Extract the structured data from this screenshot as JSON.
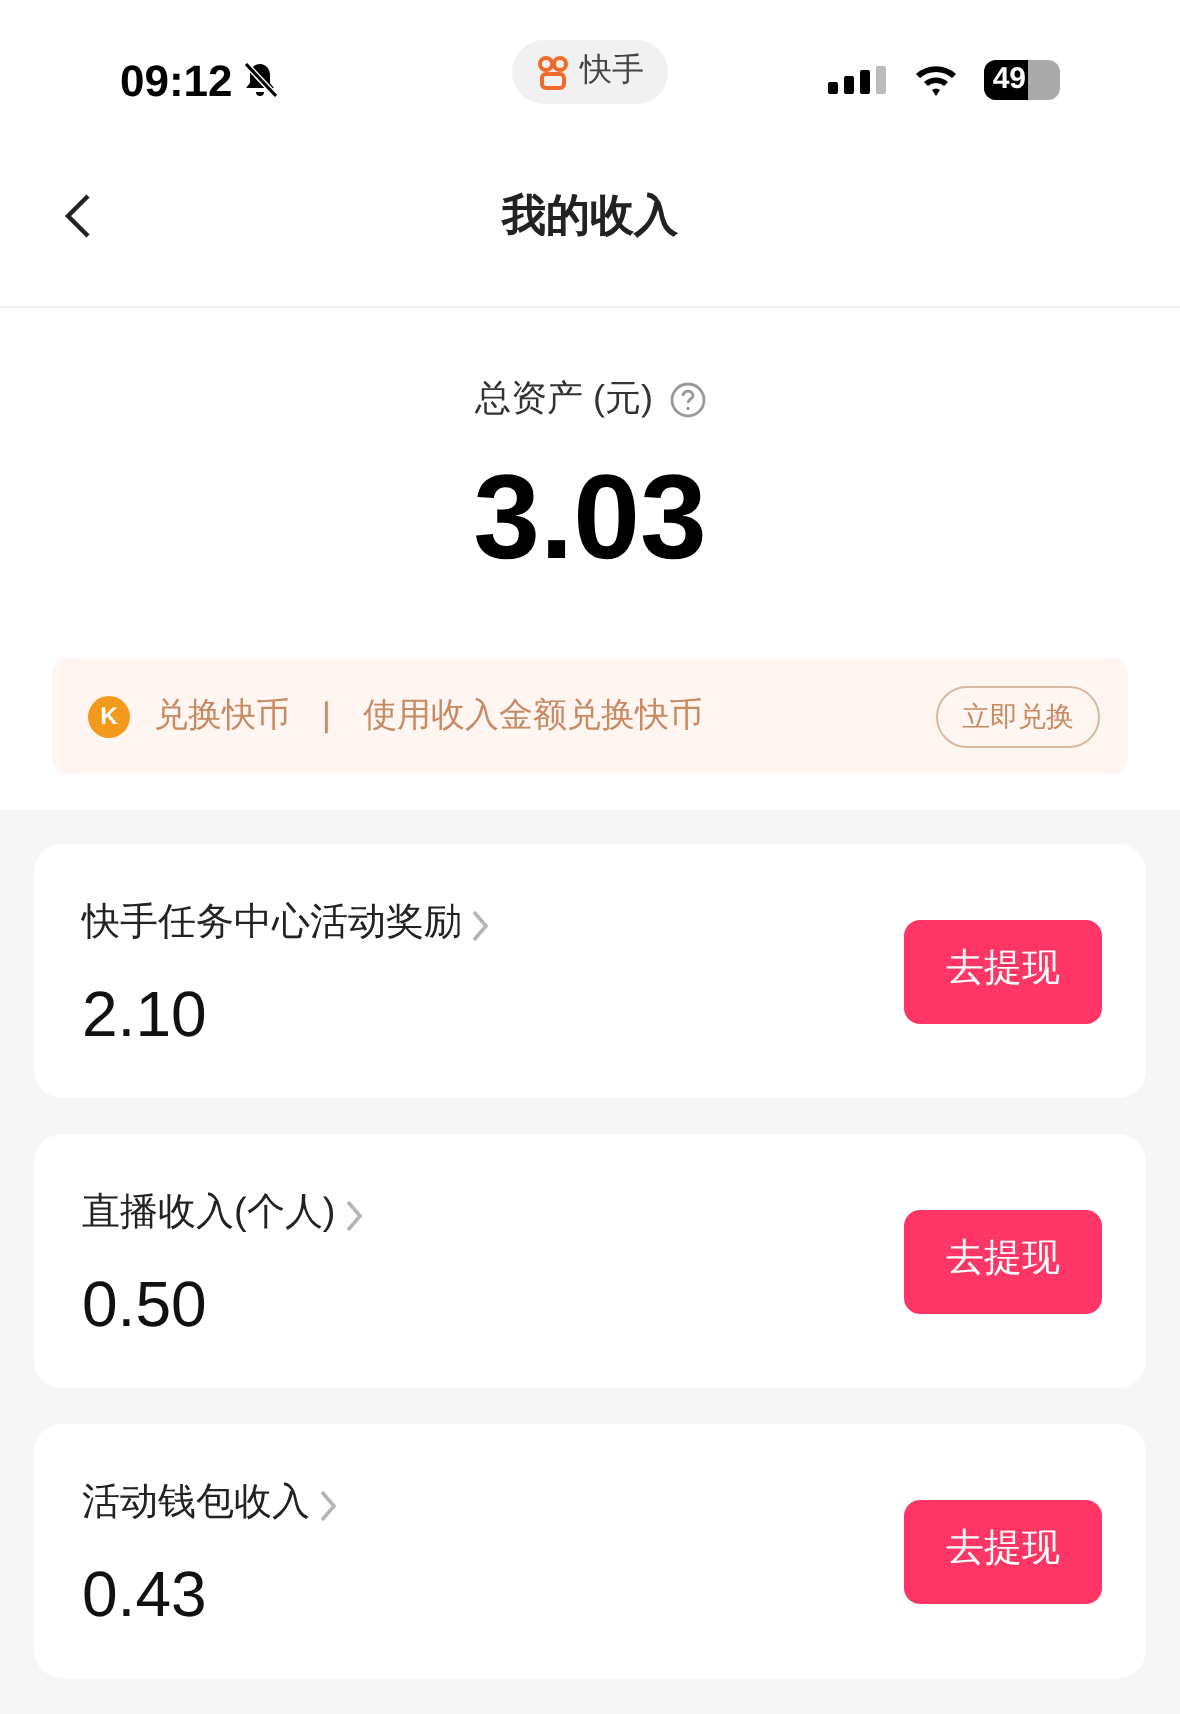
{
  "status_bar": {
    "time": "09:12",
    "app_pill": "快手",
    "battery": "49"
  },
  "header": {
    "title": "我的收入"
  },
  "total": {
    "label": "总资产 (元)",
    "amount": "3.03"
  },
  "exchange_banner": {
    "coin": "K",
    "title": "兑换快币",
    "separator": "|",
    "description": "使用收入金额兑换快币",
    "button": "立即兑换"
  },
  "income_items": [
    {
      "title": "快手任务中心活动奖励",
      "amount": "2.10",
      "button": "去提现"
    },
    {
      "title": "直播收入(个人)",
      "amount": "0.50",
      "button": "去提现"
    },
    {
      "title": "活动钱包收入",
      "amount": "0.43",
      "button": "去提现"
    }
  ]
}
